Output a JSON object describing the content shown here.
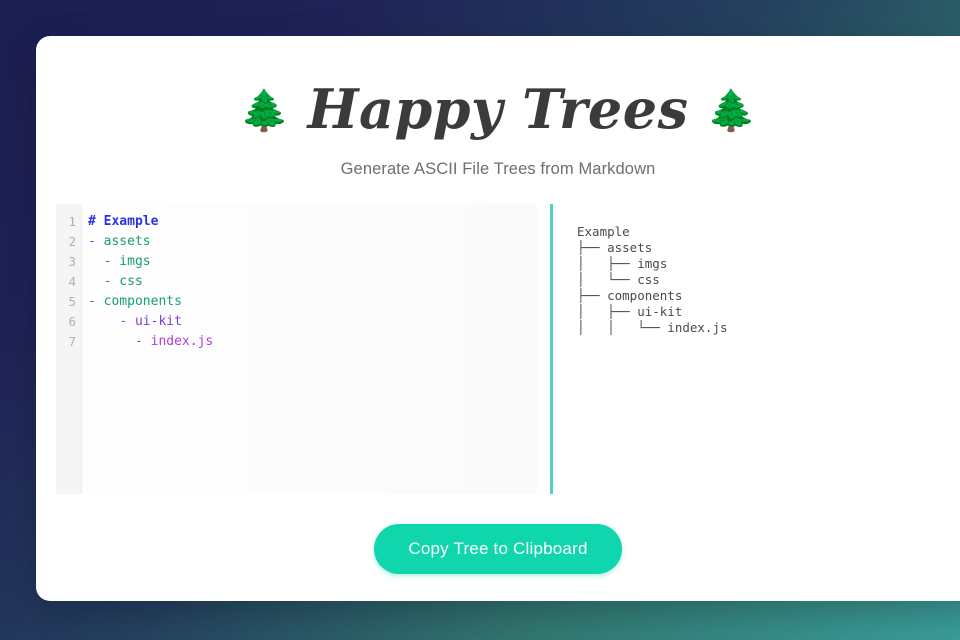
{
  "header": {
    "title": "Happy Trees",
    "subtitle": "Generate ASCII File Trees from Markdown",
    "emoji_left": "🌲",
    "emoji_right": "🌲"
  },
  "editor": {
    "line_numbers": [
      "1",
      "2",
      "3",
      "4",
      "5",
      "6",
      "7"
    ],
    "lines": [
      {
        "num": "1",
        "indent": "",
        "marker": "#",
        "text": " Example",
        "token": "tok-head"
      },
      {
        "num": "2",
        "indent": "",
        "marker": "-",
        "text": " assets",
        "token": "tok-l1b"
      },
      {
        "num": "3",
        "indent": "  ",
        "marker": "-",
        "text": " imgs",
        "token": "tok-l2"
      },
      {
        "num": "4",
        "indent": "  ",
        "marker": "-",
        "text": " css",
        "token": "tok-l2"
      },
      {
        "num": "5",
        "indent": "",
        "marker": "-",
        "text": " components",
        "token": "tok-l1b"
      },
      {
        "num": "6",
        "indent": "    ",
        "marker": "-",
        "text": " ui-kit",
        "token": "tok-l3"
      },
      {
        "num": "7",
        "indent": "      ",
        "marker": "-",
        "text": " index.js",
        "token": "tok-l4"
      }
    ],
    "raw_text": "# Example\n- assets\n  - imgs\n  - css\n- components\n    - ui-kit\n      - index.js"
  },
  "preview": {
    "lines": [
      "Example",
      "├── assets",
      "│   ├── imgs",
      "│   └── css",
      "├── components",
      "│   ├── ui-kit",
      "│   │   └── index.js"
    ]
  },
  "actions": {
    "copy_button_label": "Copy Tree to Clipboard"
  },
  "colors": {
    "accent": "#10d6ad",
    "divider": "#4fd2c0",
    "background_start": "#1d1e52",
    "background_end": "#3a9c99",
    "card": "#ffffff",
    "heading_token": "#2b32e0",
    "subtitle_text": "#6e6e73"
  }
}
